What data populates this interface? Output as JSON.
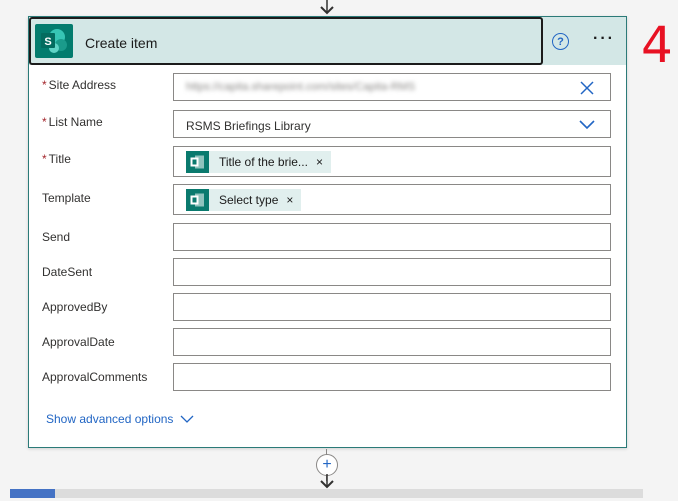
{
  "card": {
    "title": "Create item",
    "help_symbol": "?",
    "more_symbol": "···"
  },
  "fields": {
    "site_address": {
      "label": "Site Address",
      "required": "*",
      "value": "https://capita.sharepoint.com/sites/Capita-RMS"
    },
    "list_name": {
      "label": "List Name",
      "required": "*",
      "value": "RSMS Briefings Library"
    },
    "title": {
      "label": "Title",
      "required": "*",
      "token": "Title of the brie...",
      "token_remove": "×"
    },
    "template": {
      "label": "Template",
      "token": "Select type",
      "token_remove": "×"
    },
    "send": {
      "label": "Send",
      "value": ""
    },
    "date_sent": {
      "label": "DateSent",
      "value": ""
    },
    "approved_by": {
      "label": "ApprovedBy",
      "value": ""
    },
    "approval_date": {
      "label": "ApprovalDate",
      "value": ""
    },
    "approval_comments": {
      "label": "ApprovalComments",
      "value": ""
    }
  },
  "advanced_link": "Show advanced options",
  "annotation": {
    "step_number": "4"
  },
  "add_step_symbol": "+",
  "colors": {
    "accent": "#2266c4",
    "header_bg": "#d3e7e6",
    "sharepoint_teal": "#037c6e",
    "required": "#a4262c",
    "annotation_red": "#e81123"
  },
  "icons": [
    "arrow-down-icon",
    "sharepoint-icon",
    "help-icon",
    "more-icon",
    "clear-icon",
    "chevron-down-icon",
    "form-icon",
    "plus-icon"
  ],
  "scrollbar": {
    "position_fraction": 0.0
  }
}
